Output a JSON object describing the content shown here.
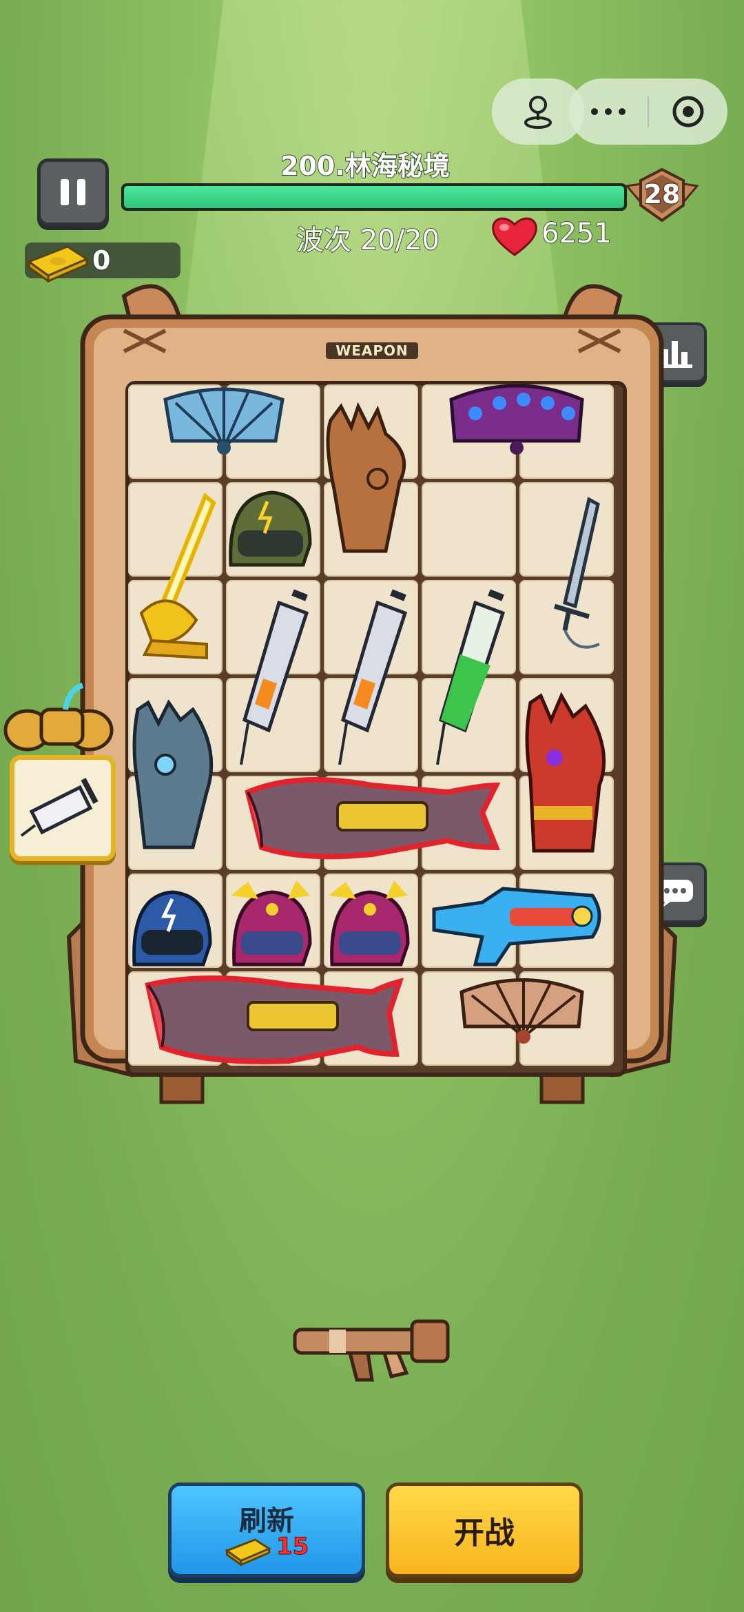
{
  "hud": {
    "level_title": "200.林海秘境",
    "progress": 1.0,
    "player_level": "28",
    "wave_text": "波次 20/20",
    "hp": "6251",
    "money": "0"
  },
  "board": {
    "label": "WEAPON",
    "rows": 7,
    "cols": 5
  },
  "buttons": {
    "refresh_label": "刷新",
    "refresh_cost": "15",
    "fight_label": "开战"
  },
  "icons": [
    "pause-icon",
    "joystick-icon",
    "more-icon",
    "target-icon",
    "stats-icon",
    "chat-icon",
    "cash-icon",
    "heart-icon",
    "fan-icon",
    "gauntlet-icon",
    "helmet-icon",
    "sword-icon",
    "syringe-icon",
    "shark-gun-icon",
    "water-gun-icon",
    "bazooka-icon"
  ],
  "colors": {
    "progress_fill": "#3ad48a",
    "refresh_button": "#2fa8f2",
    "fight_button": "#fbc42f",
    "cost_text": "#ff2e2e"
  }
}
